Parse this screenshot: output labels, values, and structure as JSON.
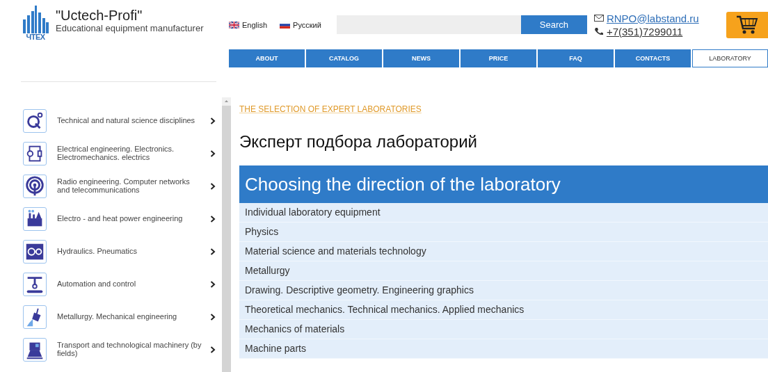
{
  "logo": {
    "mark_text": "ЧТЕХ",
    "title": "\"Uctech-Profi\"",
    "subtitle": "Educational equipment manufacturer"
  },
  "languages": [
    {
      "label": "English"
    },
    {
      "label": "Русский"
    }
  ],
  "search": {
    "button": "Search"
  },
  "contacts": {
    "email": "RNPO@labstand.ru",
    "phone": "+7(351)7299011"
  },
  "nav": [
    {
      "label": "ABOUT",
      "selected": false
    },
    {
      "label": "CATALOG",
      "selected": false
    },
    {
      "label": "NEWS",
      "selected": false
    },
    {
      "label": "PRICE",
      "selected": false
    },
    {
      "label": "FAQ",
      "selected": false
    },
    {
      "label": "CONTACTS",
      "selected": false
    },
    {
      "label": "LABORATORY",
      "selected": true
    }
  ],
  "sidebar": {
    "items": [
      {
        "label": "Technical and natural science disciplines"
      },
      {
        "label": "Electrical engineering. Electronics. Electromechanics. electrics"
      },
      {
        "label": "Radio engineering. Computer networks and telecommunications"
      },
      {
        "label": "Electro - and heat power engineering"
      },
      {
        "label": "Hydraulics. Pneumatics"
      },
      {
        "label": "Automation and control"
      },
      {
        "label": "Metallurgy. Mechanical engineering"
      },
      {
        "label": "Transport and technological machinery (by fields)"
      }
    ]
  },
  "breadcrumb": "THE SELECTION OF EXPERT LABORATORIES",
  "heading": "Эксперт подбора лабораторий",
  "directions": {
    "title": "Choosing the direction of the laboratory",
    "items": [
      "Individual laboratory equipment",
      "Physics",
      "Material science and materials technology",
      "Metallurgy",
      "Drawing. Descriptive geometry. Engineering graphics",
      "Theoretical mechanics. Technical mechanics. Applied mechanics",
      "Mechanics of materials",
      "Machine parts"
    ]
  }
}
